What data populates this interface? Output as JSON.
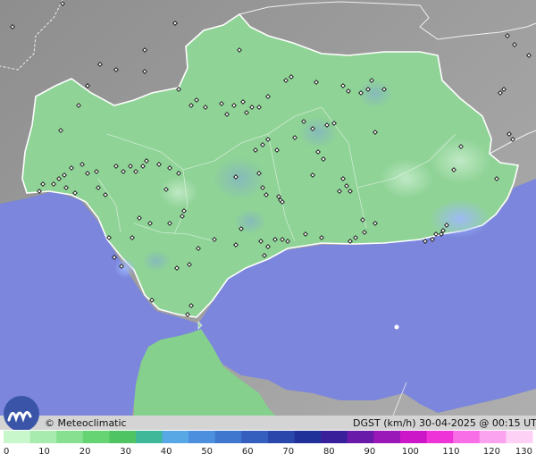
{
  "map": {
    "product": "DGST (km/h)",
    "datetime": "30-04-2025 @ 00:15 UTC",
    "credit": "© Meteoclimatic",
    "colors": {
      "sea": "#7b86dc",
      "land_outside": "#9a9a9a",
      "region_base": "#8fd396",
      "border": "#ffffff"
    }
  },
  "legend": {
    "ticks": [
      "0",
      "10",
      "20",
      "30",
      "40",
      "50",
      "60",
      "70",
      "80",
      "90",
      "100",
      "110",
      "120",
      "130"
    ],
    "colors": [
      "#c8f7cc",
      "#a7ecae",
      "#86e08f",
      "#66d472",
      "#4fc463",
      "#3fb89a",
      "#58a8e6",
      "#4c8fde",
      "#3f77cf",
      "#345fbf",
      "#2a48ab",
      "#20329a",
      "#3a1f9b",
      "#6a1aa8",
      "#9a17b8",
      "#cc17c8",
      "#ee33d8",
      "#f86ee6",
      "#fba3ef",
      "#fdd0f6"
    ]
  }
}
